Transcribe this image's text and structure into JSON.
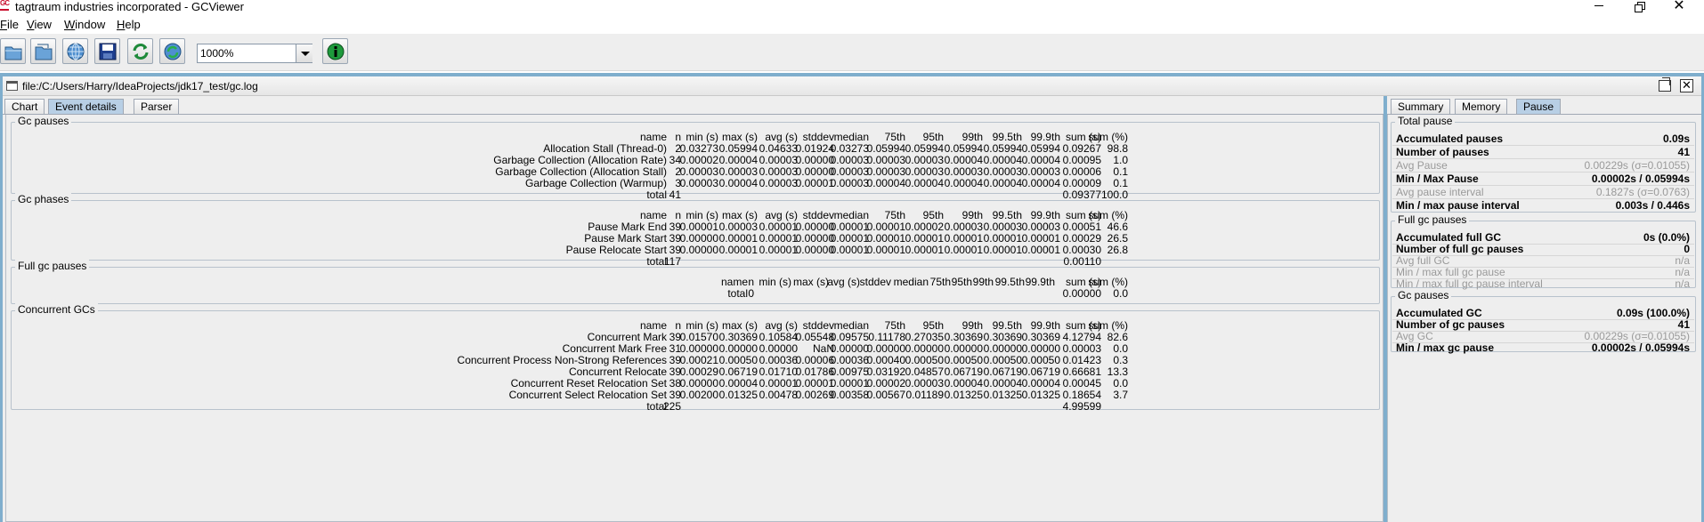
{
  "window": {
    "title": "tagtraum industries incorporated - GCViewer"
  },
  "menu": [
    {
      "mnemonic": "F",
      "rest": "ile"
    },
    {
      "mnemonic": "V",
      "rest": "iew"
    },
    {
      "mnemonic": "W",
      "rest": "indow"
    },
    {
      "mnemonic": "H",
      "rest": "elp"
    }
  ],
  "toolbar": {
    "zoom": "1000%"
  },
  "file_path": "file:/C:/Users/Harry/IdeaProjects/jdk17_test/gc.log",
  "tabs_left": [
    "Chart",
    "Event details",
    "Parser"
  ],
  "tabs_right": [
    "Summary",
    "Memory",
    "Pause"
  ],
  "headers": [
    "name",
    "n",
    "min (s)",
    "max (s)",
    "avg (s)",
    "stddev",
    "median",
    "75th",
    "95th",
    "99th",
    "99.5th",
    "99.9th",
    "sum (s)",
    "sum (%)"
  ],
  "gc_pauses": {
    "title": "Gc pauses",
    "rows": [
      [
        "Allocation Stall (Thread-0)",
        "2",
        "0.03273",
        "0.05994",
        "0.04633",
        "0.01924",
        "0.03273",
        "0.05994",
        "0.05994",
        "0.05994",
        "0.05994",
        "0.05994",
        "0.09267",
        "98.8"
      ],
      [
        "Garbage Collection (Allocation Rate)",
        "34",
        "0.00002",
        "0.00004",
        "0.00003",
        "0.00000",
        "0.00003",
        "0.00003",
        "0.00003",
        "0.00004",
        "0.00004",
        "0.00004",
        "0.00095",
        "1.0"
      ],
      [
        "Garbage Collection (Allocation Stall)",
        "2",
        "0.00003",
        "0.00003",
        "0.00003",
        "0.00000",
        "0.00003",
        "0.00003",
        "0.00003",
        "0.00003",
        "0.00003",
        "0.00003",
        "0.00006",
        "0.1"
      ],
      [
        "Garbage Collection (Warmup)",
        "3",
        "0.00003",
        "0.00004",
        "0.00003",
        "0.00001",
        "0.00003",
        "0.00004",
        "0.00004",
        "0.00004",
        "0.00004",
        "0.00004",
        "0.00009",
        "0.1"
      ]
    ],
    "total": [
      "total",
      "41",
      "",
      "",
      "",
      "",
      "",
      "",
      "",
      "",
      "",
      "",
      "0.09377",
      "100.0"
    ]
  },
  "gc_phases": {
    "title": "Gc phases",
    "rows": [
      [
        "Pause Mark End",
        "39",
        "0.00001",
        "0.00003",
        "0.00001",
        "0.00000",
        "0.00001",
        "0.00001",
        "0.00002",
        "0.00003",
        "0.00003",
        "0.00003",
        "0.00051",
        "46.6"
      ],
      [
        "Pause Mark Start",
        "39",
        "0.00000",
        "0.00001",
        "0.00001",
        "0.00000",
        "0.00001",
        "0.00001",
        "0.00001",
        "0.00001",
        "0.00001",
        "0.00001",
        "0.00029",
        "26.5"
      ],
      [
        "Pause Relocate Start",
        "39",
        "0.00000",
        "0.00001",
        "0.00001",
        "0.00000",
        "0.00001",
        "0.00001",
        "0.00001",
        "0.00001",
        "0.00001",
        "0.00001",
        "0.00030",
        "26.8"
      ]
    ],
    "total": [
      "total",
      "117",
      "",
      "",
      "",
      "",
      "",
      "",
      "",
      "",
      "",
      "",
      "0.00110",
      ""
    ]
  },
  "full_gc_pauses": {
    "title": "Full gc pauses",
    "total": [
      "total",
      "0",
      "",
      "",
      "",
      "",
      "",
      "",
      "",
      "",
      "",
      "",
      "0.00000",
      "0.0"
    ]
  },
  "concurrent_gcs": {
    "title": "Concurrent GCs",
    "rows": [
      [
        "Concurrent Mark",
        "39",
        "0.01570",
        "0.30369",
        "0.10584",
        "0.05548",
        "0.09575",
        "0.11178",
        "0.27035",
        "0.30369",
        "0.30369",
        "0.30369",
        "4.12794",
        "82.6"
      ],
      [
        "Concurrent Mark Free",
        "31",
        "0.00000",
        "0.00000",
        "0.00000",
        "NaN",
        "0.00000",
        "0.00000",
        "0.00000",
        "0.00000",
        "0.00000",
        "0.00000",
        "0.00003",
        "0.0"
      ],
      [
        "Concurrent Process Non-Strong References",
        "39",
        "0.00021",
        "0.00050",
        "0.00036",
        "0.00006",
        "0.00036",
        "0.00040",
        "0.00050",
        "0.00050",
        "0.00050",
        "0.00050",
        "0.01423",
        "0.3"
      ],
      [
        "Concurrent Relocate",
        "39",
        "0.00029",
        "0.06719",
        "0.01710",
        "0.01786",
        "0.00975",
        "0.03192",
        "0.04857",
        "0.06719",
        "0.06719",
        "0.06719",
        "0.66681",
        "13.3"
      ],
      [
        "Concurrent Reset Relocation Set",
        "38",
        "0.00000",
        "0.00004",
        "0.00001",
        "0.00001",
        "0.00001",
        "0.00002",
        "0.00003",
        "0.00004",
        "0.00004",
        "0.00004",
        "0.00045",
        "0.0"
      ],
      [
        "Concurrent Select Relocation Set",
        "39",
        "0.00200",
        "0.01325",
        "0.00478",
        "0.00269",
        "0.00358",
        "0.00567",
        "0.01189",
        "0.01325",
        "0.01325",
        "0.01325",
        "0.18654",
        "3.7"
      ]
    ],
    "total": [
      "total",
      "225",
      "",
      "",
      "",
      "",
      "",
      "",
      "",
      "",
      "",
      "",
      "4.99599",
      ""
    ]
  },
  "pause_panel": {
    "total_pause": {
      "title": "Total pause",
      "items": [
        {
          "label": "Accumulated pauses",
          "value": "0.09s",
          "dim": false
        },
        {
          "label": "Number of pauses",
          "value": "41",
          "dim": false
        },
        {
          "label": "Avg Pause",
          "value": "0.00229s (σ=0.01055)",
          "dim": true
        },
        {
          "label": "Min / Max Pause",
          "value": "0.00002s / 0.05994s",
          "dim": false
        },
        {
          "label": "Avg pause interval",
          "value": "0.1827s (σ=0.0763)",
          "dim": true
        },
        {
          "label": "Min / max pause interval",
          "value": "0.003s / 0.446s",
          "dim": false
        }
      ]
    },
    "full_gc_pauses": {
      "title": "Full gc pauses",
      "items": [
        {
          "label": "Accumulated full GC",
          "value": "0s (0.0%)",
          "dim": false
        },
        {
          "label": "Number of full gc pauses",
          "value": "0",
          "dim": false
        },
        {
          "label": "Avg full GC",
          "value": "n/a",
          "dim": true
        },
        {
          "label": "Min / max full gc pause",
          "value": "n/a",
          "dim": true
        },
        {
          "label": "Min / max full gc pause interval",
          "value": "n/a",
          "dim": true
        }
      ]
    },
    "gc_pauses": {
      "title": "Gc pauses",
      "items": [
        {
          "label": "Accumulated GC",
          "value": "0.09s (100.0%)",
          "dim": false
        },
        {
          "label": "Number of gc pauses",
          "value": "41",
          "dim": false
        },
        {
          "label": "Avg GC",
          "value": "0.00229s (σ=0.01055)",
          "dim": true
        },
        {
          "label": "Min / max gc pause",
          "value": "0.00002s / 0.05994s",
          "dim": false
        }
      ]
    }
  }
}
